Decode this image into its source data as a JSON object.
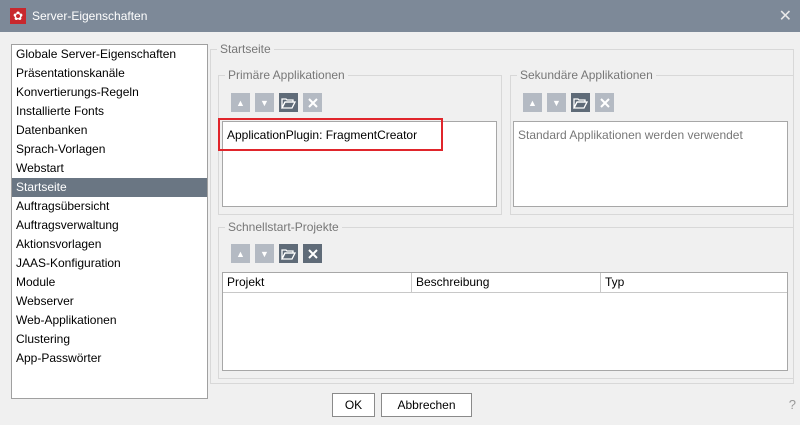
{
  "window": {
    "title": "Server-Eigenschaften",
    "app_icon": "gear-icon",
    "close_glyph": "✕"
  },
  "sidebar": {
    "items": [
      {
        "label": "Globale Server-Eigenschaften"
      },
      {
        "label": "Präsentationskanäle"
      },
      {
        "label": "Konvertierungs-Regeln"
      },
      {
        "label": "Installierte Fonts"
      },
      {
        "label": "Datenbanken"
      },
      {
        "label": "Sprach-Vorlagen"
      },
      {
        "label": "Webstart"
      },
      {
        "label": "Startseite",
        "selected": true
      },
      {
        "label": "Auftragsübersicht"
      },
      {
        "label": "Auftragsverwaltung"
      },
      {
        "label": "Aktionsvorlagen"
      },
      {
        "label": "JAAS-Konfiguration"
      },
      {
        "label": "Module"
      },
      {
        "label": "Webserver"
      },
      {
        "label": "Web-Applikationen"
      },
      {
        "label": "Clustering"
      },
      {
        "label": "App-Passwörter"
      }
    ]
  },
  "main": {
    "group_title": "Startseite",
    "primary": {
      "title": "Primäre Applikationen",
      "entries": [
        "ApplicationPlugin: FragmentCreator"
      ]
    },
    "secondary": {
      "title": "Sekundäre Applikationen",
      "entries": [
        "Standard Applikationen werden verwendet"
      ]
    },
    "quickstart": {
      "title": "Schnellstart-Projekte",
      "columns": [
        "Projekt",
        "Beschreibung",
        "Typ"
      ]
    }
  },
  "footer": {
    "ok_label": "OK",
    "cancel_label": "Abbrechen",
    "help_glyph": "?"
  },
  "colors": {
    "titlebar": "#7d8998",
    "selection": "#6a7683",
    "highlight": "#e0252b"
  }
}
